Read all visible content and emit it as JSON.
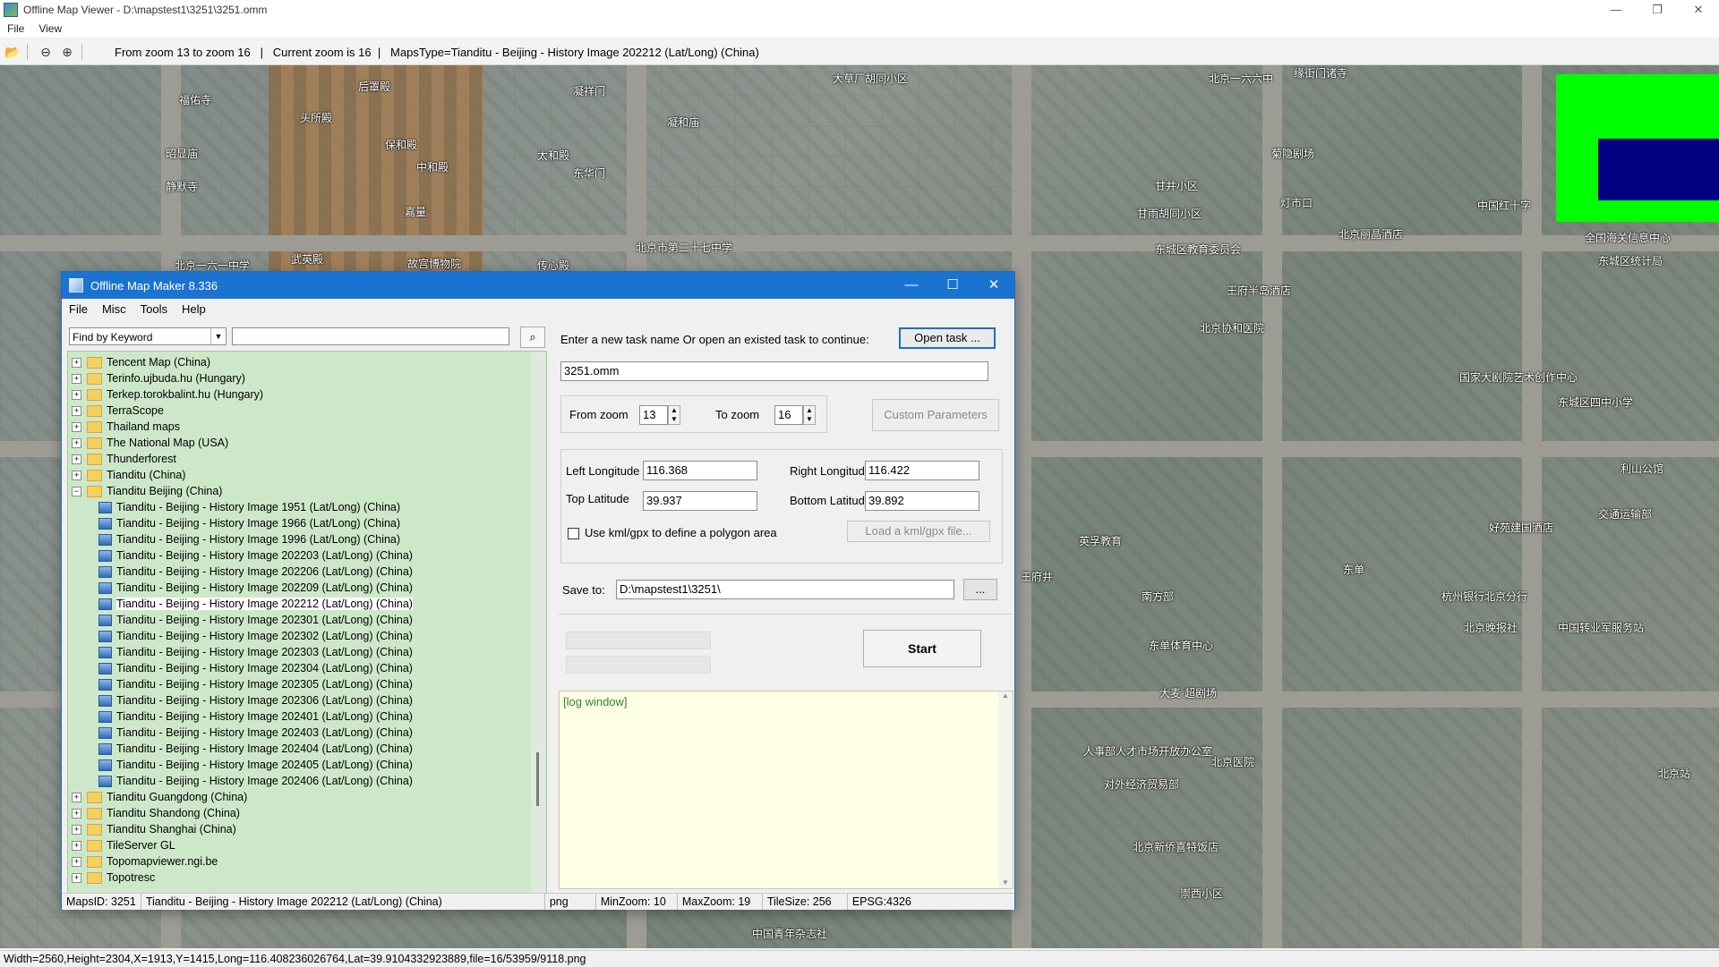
{
  "viewer": {
    "title": "Offline Map Viewer - D:\\mapstest1\\3251\\3251.omm",
    "menu": [
      "File",
      "View"
    ],
    "toolbar_info": "From zoom 13 to zoom 16   |   Current zoom is 16  |   MapsType=Tianditu - Beijing - History Image 202212 (Lat/Long) (China)",
    "status": "Width=2560,Height=2304,X=1913,Y=1415,Long=116.408236026764,Lat=39.9104332923889,file=16/53959/9118.png",
    "window_controls": [
      "—",
      "❐",
      "✕"
    ]
  },
  "map": {
    "labels": [
      "后罩殿",
      "凝祥门",
      "大草厂胡同小区",
      "北京一六六中",
      "缘街门诸寺",
      "福佑寺",
      "头所殿",
      "凝和庙",
      "保和殿",
      "中和殿",
      "昭显庙",
      "静默寺",
      "太和殿",
      "东华门",
      "嘉量",
      "菊隐剧场",
      "甘井小区",
      "甘雨胡同小区",
      "中国红十字",
      "北京一六一中学",
      "武英殿",
      "故宫博物院",
      "传心殿",
      "北京市第二十七中学",
      "北京丽晶酒店",
      "东城区教育委员会",
      "王府半岛酒店",
      "全国海关信息中心",
      "东城区统计局",
      "北京协和医院",
      "国家大剧院艺术创作中心",
      "东城区四中小学",
      "利山公馆",
      "英孚教育",
      "好苑建国酒店",
      "交通运输部",
      "东单",
      "南方部",
      "杭州银行北京分行",
      "北京晚报社",
      "中国转业军服务站",
      "东单体育中心",
      "大麦·超剧场",
      "人事部人才市场开放办公室",
      "对外经济贸易部",
      "北京医院",
      "北京站",
      "北京新侨喜特饭店",
      "崇西小区",
      "中国青年杂志社",
      "灯市口",
      "王府井"
    ],
    "colors": {
      "legend_green": "#00ff00",
      "legend_navy": "#000080"
    }
  },
  "maker": {
    "title": "Offline Map Maker 8.336",
    "menu": [
      "File",
      "Misc",
      "Tools",
      "Help"
    ],
    "find_mode": "Find by Keyword",
    "search_value": "",
    "tree": [
      {
        "label": "Tencent Map (China)",
        "type": "folder",
        "expanded": false
      },
      {
        "label": "Terinfo.ujbuda.hu (Hungary)",
        "type": "folder",
        "expanded": false
      },
      {
        "label": "Terkep.torokbalint.hu (Hungary)",
        "type": "folder",
        "expanded": false
      },
      {
        "label": "TerraScope",
        "type": "folder",
        "expanded": false
      },
      {
        "label": "Thailand maps",
        "type": "folder",
        "expanded": false
      },
      {
        "label": "The National Map (USA)",
        "type": "folder",
        "expanded": false
      },
      {
        "label": "Thunderforest",
        "type": "folder",
        "expanded": false
      },
      {
        "label": "Tianditu (China)",
        "type": "folder",
        "expanded": false
      },
      {
        "label": "Tianditu Beijing (China)",
        "type": "folder",
        "expanded": true
      },
      {
        "label": "Tianditu - Beijing - History Image 1951 (Lat/Long) (China)",
        "type": "map"
      },
      {
        "label": "Tianditu - Beijing - History Image 1966 (Lat/Long) (China)",
        "type": "map"
      },
      {
        "label": "Tianditu - Beijing - History Image 1996 (Lat/Long) (China)",
        "type": "map"
      },
      {
        "label": "Tianditu - Beijing - History Image 202203 (Lat/Long) (China)",
        "type": "map"
      },
      {
        "label": "Tianditu - Beijing - History Image 202206 (Lat/Long) (China)",
        "type": "map"
      },
      {
        "label": "Tianditu - Beijing - History Image 202209 (Lat/Long) (China)",
        "type": "map"
      },
      {
        "label": "Tianditu - Beijing - History Image 202212 (Lat/Long) (China)",
        "type": "map",
        "selected": true
      },
      {
        "label": "Tianditu - Beijing - History Image 202301 (Lat/Long) (China)",
        "type": "map"
      },
      {
        "label": "Tianditu - Beijing - History Image 202302 (Lat/Long) (China)",
        "type": "map"
      },
      {
        "label": "Tianditu - Beijing - History Image 202303 (Lat/Long) (China)",
        "type": "map"
      },
      {
        "label": "Tianditu - Beijing - History Image 202304 (Lat/Long) (China)",
        "type": "map"
      },
      {
        "label": "Tianditu - Beijing - History Image 202305 (Lat/Long) (China)",
        "type": "map"
      },
      {
        "label": "Tianditu - Beijing - History Image 202306 (Lat/Long) (China)",
        "type": "map"
      },
      {
        "label": "Tianditu - Beijing - History Image 202401 (Lat/Long) (China)",
        "type": "map"
      },
      {
        "label": "Tianditu - Beijing - History Image 202403 (Lat/Long) (China)",
        "type": "map"
      },
      {
        "label": "Tianditu - Beijing - History Image 202404 (Lat/Long) (China)",
        "type": "map"
      },
      {
        "label": "Tianditu - Beijing - History Image 202405 (Lat/Long) (China)",
        "type": "map"
      },
      {
        "label": "Tianditu - Beijing - History Image 202406 (Lat/Long) (China)",
        "type": "map"
      },
      {
        "label": "Tianditu Guangdong (China)",
        "type": "folder",
        "expanded": false
      },
      {
        "label": "Tianditu Shandong (China)",
        "type": "folder",
        "expanded": false
      },
      {
        "label": "Tianditu Shanghai (China)",
        "type": "folder",
        "expanded": false
      },
      {
        "label": "TileServer GL",
        "type": "folder",
        "expanded": false
      },
      {
        "label": "Topomapviewer.ngi.be",
        "type": "folder",
        "expanded": false
      },
      {
        "label": "Topotresc",
        "type": "folder",
        "expanded": false
      }
    ],
    "task": {
      "prompt": "Enter a new task name Or open an existed task to continue:",
      "open_button": "Open task ...",
      "task_name": "3251.omm",
      "from_zoom_label": "From zoom",
      "from_zoom": "13",
      "to_zoom_label": "To zoom",
      "to_zoom": "16",
      "custom_params": "Custom Parameters",
      "left_lon_label": "Left Longitude",
      "left_lon": "116.368",
      "right_lon_label": "Right Longitude",
      "right_lon": "116.422",
      "top_lat_label": "Top Latitude",
      "top_lat": "39.937",
      "bottom_lat_label": "Bottom Latitude",
      "bottom_lat": "39.892",
      "kml_checkbox": "Use kml/gpx to define a polygon area",
      "kml_button": "Load a kml/gpx file...",
      "save_label": "Save to:",
      "save_path": "D:\\mapstest1\\3251\\",
      "browse": "...",
      "start": "Start",
      "log_placeholder": "[log window]"
    },
    "status": {
      "maps_id": "MapsID: 3251",
      "maps_name": "Tianditu - Beijing - History Image 202212 (Lat/Long) (China)",
      "format": "png",
      "min_zoom": "MinZoom: 10",
      "max_zoom": "MaxZoom: 19",
      "tile_size": "TileSize: 256",
      "epsg": "EPSG:4326"
    }
  }
}
